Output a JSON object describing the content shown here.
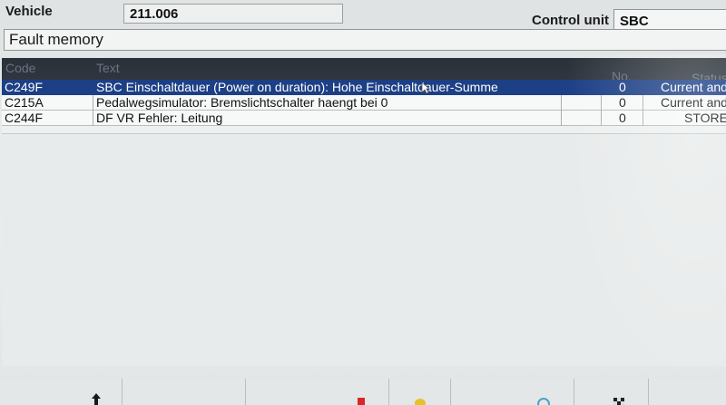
{
  "header": {
    "vehicle_label": "Vehicle",
    "vehicle_value": "211.006",
    "control_unit_label": "Control unit",
    "control_unit_value": "SBC"
  },
  "panel": {
    "title": "Fault memory"
  },
  "table": {
    "columns": [
      "Code",
      "Text",
      "No.",
      "Status"
    ],
    "rows": [
      {
        "code": "C249F",
        "text": "SBC Einschaltdauer (Power on duration): Hohe Einschaltdauer-Summe",
        "no": "0",
        "status": "Current and",
        "selected": true
      },
      {
        "code": "C215A",
        "text": "Pedalwegsimulator: Bremslichtschalter haengt bei 0",
        "no": "0",
        "status": "Current and",
        "selected": false
      },
      {
        "code": "C244F",
        "text": "DF VR Fehler: Leitung",
        "no": "0",
        "status": "STORE",
        "selected": false
      }
    ]
  },
  "colors": {
    "selection": "#1c3f86",
    "header_bg": "#2b3139"
  },
  "bottom_toolbar": {
    "icons": [
      "up-arrow-icon",
      "red-marker-icon",
      "yellow-key-icon",
      "magnifier-icon",
      "checkered-flag-icon"
    ]
  }
}
